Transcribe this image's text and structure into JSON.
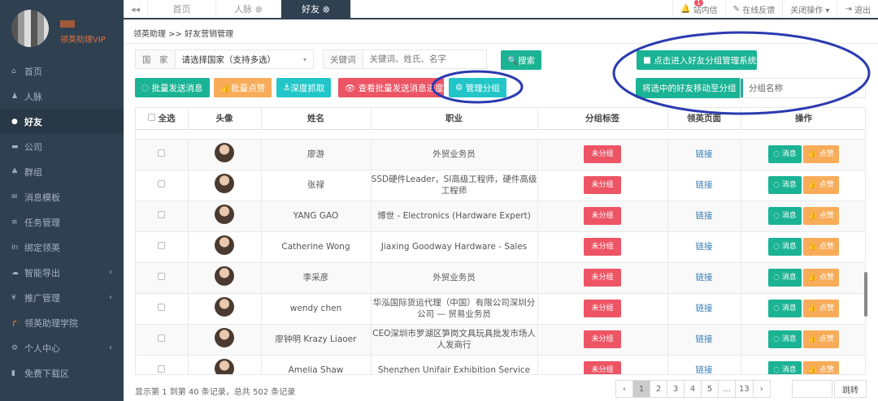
{
  "user": {
    "level": "领英助理VIP"
  },
  "sidebar": {
    "items": [
      {
        "label": "首页",
        "icon": "home-icon",
        "glyph": "⌂"
      },
      {
        "label": "人脉",
        "icon": "users-icon",
        "glyph": "♟"
      },
      {
        "label": "好友",
        "icon": "comments-icon",
        "glyph": "●",
        "active": true
      },
      {
        "label": "公司",
        "icon": "briefcase-icon",
        "glyph": "▬"
      },
      {
        "label": "群组",
        "icon": "group-icon",
        "glyph": "♣"
      },
      {
        "label": "消息模板",
        "icon": "envelope-icon",
        "glyph": "✉"
      },
      {
        "label": "任务管理",
        "icon": "tasks-icon",
        "glyph": "≡"
      },
      {
        "label": "绑定领英",
        "icon": "linkedin-icon",
        "glyph": "in"
      },
      {
        "label": "智能导出",
        "icon": "cloud-download-icon",
        "glyph": "☁",
        "chev": "‹"
      },
      {
        "label": "推广管理",
        "icon": "yen-icon",
        "glyph": "¥",
        "chev": "‹"
      },
      {
        "label": "领英助理学院",
        "icon": "graduation-cap-icon",
        "glyph": "🎓"
      },
      {
        "label": "个人中心",
        "icon": "gear-icon",
        "glyph": "⚙",
        "chev": "‹"
      },
      {
        "label": "免费下载区",
        "icon": "file-icon",
        "glyph": "▮"
      }
    ]
  },
  "tabs": [
    {
      "label": "首页"
    },
    {
      "label": "人脉 ⊗"
    },
    {
      "label": "好友 ⊗"
    }
  ],
  "topright": {
    "messages": "站内信",
    "badge": "1",
    "feedback": "在线反馈",
    "close_ops": "关闭操作 ▾",
    "logout": "退出"
  },
  "breadcrumb": "领英助理  >>  好友营销管理",
  "filters": {
    "country_label": "国　家",
    "country_value": "请选择国家（支持多选）",
    "keyword_label": "关键词",
    "keyword_placeholder": "关键词、姓氏、名字",
    "search": "搜索"
  },
  "actions": {
    "batch_send": "批量发送消息",
    "batch_like": "批量点赞",
    "deep_fetch": "深度抓取",
    "view_progress": "查看批量发送消息进度",
    "manage_groups": "管理分组",
    "group_system": "点击进入好友分组管理系统",
    "move_to_group": "将选中的好友移动至分组",
    "group_name": "分组名称"
  },
  "table": {
    "headers": [
      "全选",
      "头像",
      "姓名",
      "职业",
      "分组标签",
      "领英页面",
      "操作"
    ],
    "rows": [
      {
        "name": "廖游",
        "job": "外贸业务员"
      },
      {
        "name": "张禄",
        "job": "SSD硬件Leader，SI高级工程师，硬件高级工程师"
      },
      {
        "name": "YANG GAO",
        "job": "博世 - Electronics (Hardware Expert)"
      },
      {
        "name": "Catherine Wong",
        "job": "Jiaxing Goodway Hardware - Sales"
      },
      {
        "name": "李采彦",
        "job": "外贸业务员"
      },
      {
        "name": "wendy chen",
        "job": "华泓国际货运代理（中国）有限公司深圳分公司 — 贸易业务员"
      },
      {
        "name": "廖钟明 Krazy Liaoer",
        "job": "CEO深圳市罗湖区笋岗文具玩具批发市场人人发商行"
      },
      {
        "name": "Amelia Shaw",
        "job": "Shenzhen Unifair Exhibition Service"
      }
    ],
    "tag": "未分组",
    "link": "链接",
    "msg": "◌ 消息",
    "like": "👍 点赞"
  },
  "footer": {
    "summary": "显示第 1 到第 40 条记录，总共 502 条记录",
    "pages": [
      "‹",
      "1",
      "2",
      "3",
      "4",
      "5",
      "...",
      "13",
      "›"
    ],
    "jump": "跳转"
  }
}
